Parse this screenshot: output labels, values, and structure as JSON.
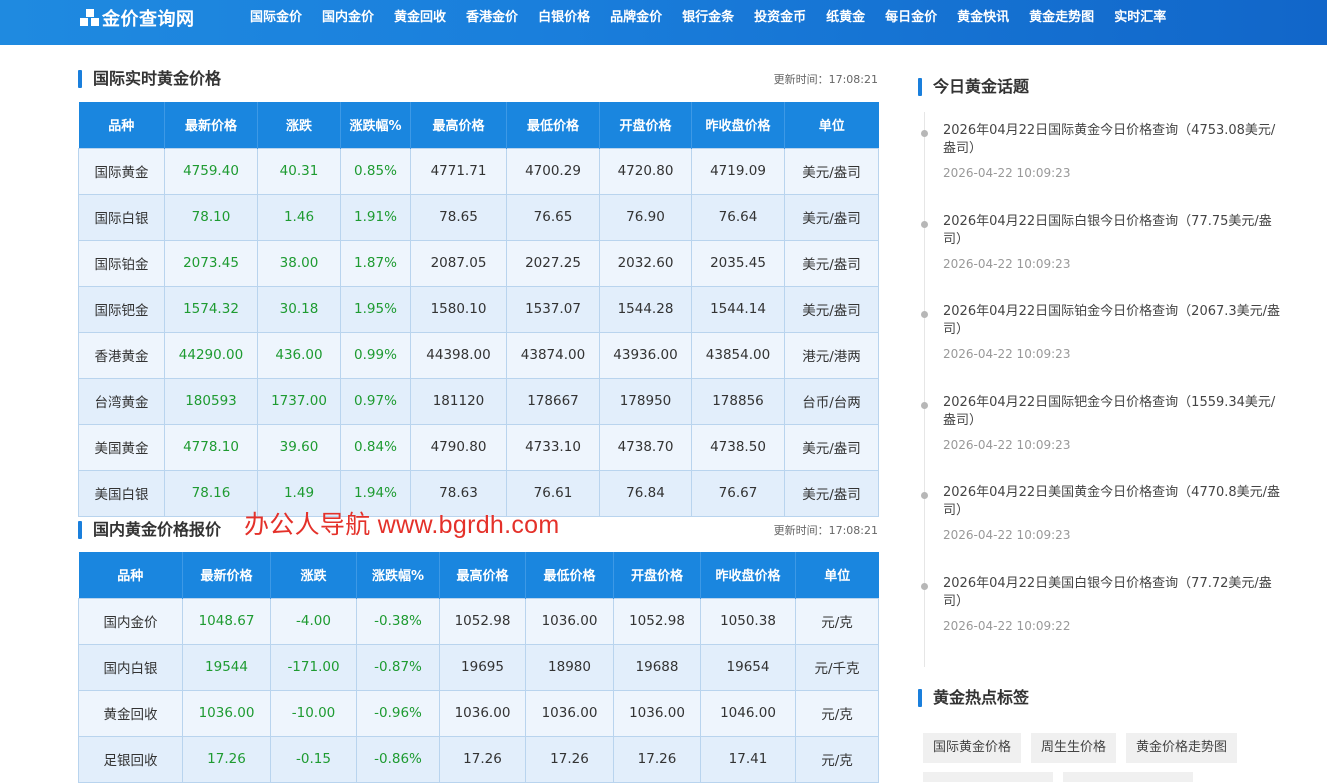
{
  "site": {
    "logo": "金价查询网"
  },
  "nav": [
    "国际金价",
    "国内金价",
    "黄金回收",
    "香港金价",
    "白银价格",
    "品牌金价",
    "银行金条",
    "投资金币",
    "纸黄金",
    "每日金价",
    "黄金快讯",
    "黄金走势图",
    "实时汇率"
  ],
  "international": {
    "title": "国际实时黄金价格",
    "updated": "更新时间：17:08:21",
    "headers": [
      "品种",
      "最新价格",
      "涨跌",
      "涨跌幅%",
      "最高价格",
      "最低价格",
      "开盘价格",
      "昨收盘价格",
      "单位"
    ],
    "rows": [
      [
        "国际黄金",
        "4759.40",
        "40.31",
        "0.85%",
        "4771.71",
        "4700.29",
        "4720.80",
        "4719.09",
        "美元/盎司"
      ],
      [
        "国际白银",
        "78.10",
        "1.46",
        "1.91%",
        "78.65",
        "76.65",
        "76.90",
        "76.64",
        "美元/盎司"
      ],
      [
        "国际铂金",
        "2073.45",
        "38.00",
        "1.87%",
        "2087.05",
        "2027.25",
        "2032.60",
        "2035.45",
        "美元/盎司"
      ],
      [
        "国际钯金",
        "1574.32",
        "30.18",
        "1.95%",
        "1580.10",
        "1537.07",
        "1544.28",
        "1544.14",
        "美元/盎司"
      ],
      [
        "香港黄金",
        "44290.00",
        "436.00",
        "0.99%",
        "44398.00",
        "43874.00",
        "43936.00",
        "43854.00",
        "港元/港两"
      ],
      [
        "台湾黄金",
        "180593",
        "1737.00",
        "0.97%",
        "181120",
        "178667",
        "178950",
        "178856",
        "台币/台两"
      ],
      [
        "美国黄金",
        "4778.10",
        "39.60",
        "0.84%",
        "4790.80",
        "4733.10",
        "4738.70",
        "4738.50",
        "美元/盎司"
      ],
      [
        "美国白银",
        "78.16",
        "1.49",
        "1.94%",
        "78.63",
        "76.61",
        "76.84",
        "76.67",
        "美元/盎司"
      ]
    ]
  },
  "domestic": {
    "title": "国内黄金价格报价",
    "updated": "更新时间：17:08:21",
    "headers": [
      "品种",
      "最新价格",
      "涨跌",
      "涨跌幅%",
      "最高价格",
      "最低价格",
      "开盘价格",
      "昨收盘价格",
      "单位"
    ],
    "rows": [
      [
        "国内金价",
        "1048.67",
        "-4.00",
        "-0.38%",
        "1052.98",
        "1036.00",
        "1052.98",
        "1050.38",
        "元/克"
      ],
      [
        "国内白银",
        "19544",
        "-171.00",
        "-0.87%",
        "19695",
        "18980",
        "19688",
        "19654",
        "元/千克"
      ],
      [
        "黄金回收",
        "1036.00",
        "-10.00",
        "-0.96%",
        "1036.00",
        "1036.00",
        "1036.00",
        "1046.00",
        "元/克"
      ],
      [
        "足银回收",
        "17.26",
        "-0.15",
        "-0.86%",
        "17.26",
        "17.26",
        "17.26",
        "17.41",
        "元/克"
      ]
    ]
  },
  "watermark": "办公人导航 www.bgrdh.com",
  "topics": {
    "title": "今日黄金话题",
    "items": [
      {
        "title": "2026年04月22日国际黄金今日价格查询（4753.08美元/盎司）",
        "time": "2026-04-22 10:09:23"
      },
      {
        "title": "2026年04月22日国际白银今日价格查询（77.75美元/盎司）",
        "time": "2026-04-22 10:09:23"
      },
      {
        "title": "2026年04月22日国际铂金今日价格查询（2067.3美元/盎司）",
        "time": "2026-04-22 10:09:23"
      },
      {
        "title": "2026年04月22日国际钯金今日价格查询（1559.34美元/盎司）",
        "time": "2026-04-22 10:09:23"
      },
      {
        "title": "2026年04月22日美国黄金今日价格查询（4770.8美元/盎司）",
        "time": "2026-04-22 10:09:23"
      },
      {
        "title": "2026年04月22日美国白银今日价格查询（77.72美元/盎司）",
        "time": "2026-04-22 10:09:22"
      }
    ]
  },
  "tags": {
    "title": "黄金热点标签",
    "items": [
      "国际黄金价格",
      "周生生价格",
      "黄金价格走势图"
    ]
  },
  "colors": {
    "accent": "#1a86df",
    "up": "#1e9b31",
    "watermark": "#e4312a"
  }
}
